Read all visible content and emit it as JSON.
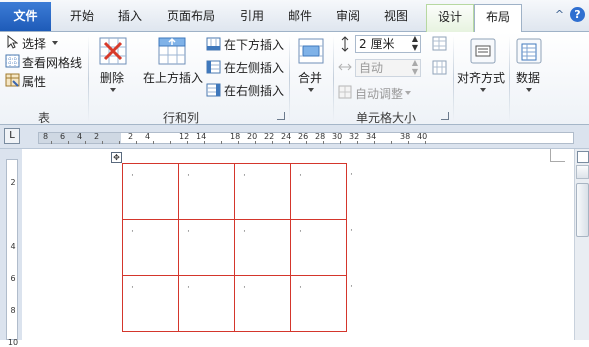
{
  "tabs": [
    {
      "label": "文件",
      "id": "file"
    },
    {
      "label": "开始",
      "id": "home"
    },
    {
      "label": "插入",
      "id": "insert"
    },
    {
      "label": "页面布局",
      "id": "page-layout"
    },
    {
      "label": "引用",
      "id": "references"
    },
    {
      "label": "邮件",
      "id": "mailings"
    },
    {
      "label": "审阅",
      "id": "review"
    },
    {
      "label": "视图",
      "id": "view"
    },
    {
      "label": "设计",
      "id": "design"
    },
    {
      "label": "布局",
      "id": "layout"
    }
  ],
  "window_icons": {
    "minimize": "^",
    "help": "?"
  },
  "groups": {
    "table": {
      "label": "表",
      "select": "选择",
      "view_gridlines": "查看网格线",
      "properties": "属性"
    },
    "rows_cols": {
      "label": "行和列",
      "delete": "删除",
      "insert_above": "在上方插入",
      "insert_below": "在下方插入",
      "insert_left": "在左侧插入",
      "insert_right": "在右侧插入"
    },
    "merge": {
      "label": "合并"
    },
    "cell_size": {
      "label": "单元格大小",
      "height_value": "2 厘米",
      "width_value": "自动",
      "autofit": "自动调整"
    },
    "alignment": {
      "label": "对齐方式"
    },
    "data": {
      "label": "数据"
    }
  },
  "ruler": {
    "marks": [
      "8",
      "6",
      "4",
      "2",
      "",
      "2",
      "4",
      "",
      "12",
      "14",
      "",
      "18",
      "20",
      "22",
      "24",
      "26",
      "28",
      "30",
      "32",
      "34",
      "",
      "38",
      "40"
    ],
    "corner": "L"
  },
  "vruler": {
    "marks": [
      "2",
      "",
      "4",
      "6",
      "8",
      "10"
    ]
  },
  "table": {
    "rows": 3,
    "cols": 4,
    "cell_mark": "·"
  },
  "colors": {
    "table_border": "#d4362c",
    "file_tab": "#2a63c0",
    "context_tab_border": "#b7d8a1"
  }
}
